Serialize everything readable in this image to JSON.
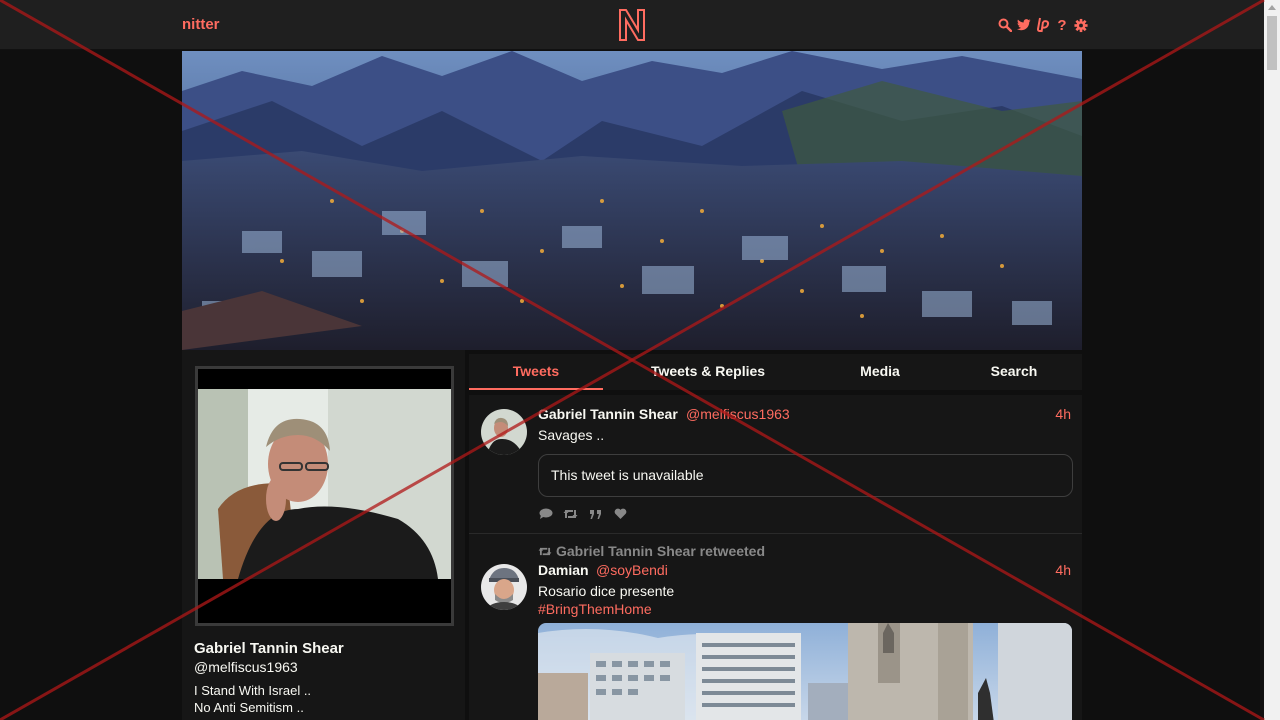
{
  "navbar": {
    "brand": "nitter",
    "icons": [
      "search-icon",
      "twitter-icon",
      "liberapay-icon",
      "help-icon",
      "gear-icon"
    ],
    "help_glyph": "?"
  },
  "colors": {
    "accent": "#ff6c60",
    "background": "#0f0f0f",
    "panel": "#161616",
    "navbar": "#1f1f1f"
  },
  "profile": {
    "name": "Gabriel Tannin Shear",
    "handle": "@melfiscus1963",
    "bio_line1": "I Stand With Israel ..",
    "bio_line2": "No Anti Semitism .."
  },
  "tabs": [
    {
      "label": "Tweets",
      "active": true
    },
    {
      "label": "Tweets & Replies",
      "active": false
    },
    {
      "label": "Media",
      "active": false
    },
    {
      "label": "Search",
      "active": false
    }
  ],
  "tweets": [
    {
      "name": "Gabriel Tannin Shear",
      "handle": "@melfiscus1963",
      "date": "4h",
      "text": "Savages ..",
      "quote": "This tweet is unavailable"
    },
    {
      "retweet_label": "Gabriel Tannin Shear retweeted",
      "name": "Damian",
      "handle": "@soyBendi",
      "date": "4h",
      "text": "Rosario dice presente",
      "hashtag": "#BringThemHome"
    }
  ]
}
